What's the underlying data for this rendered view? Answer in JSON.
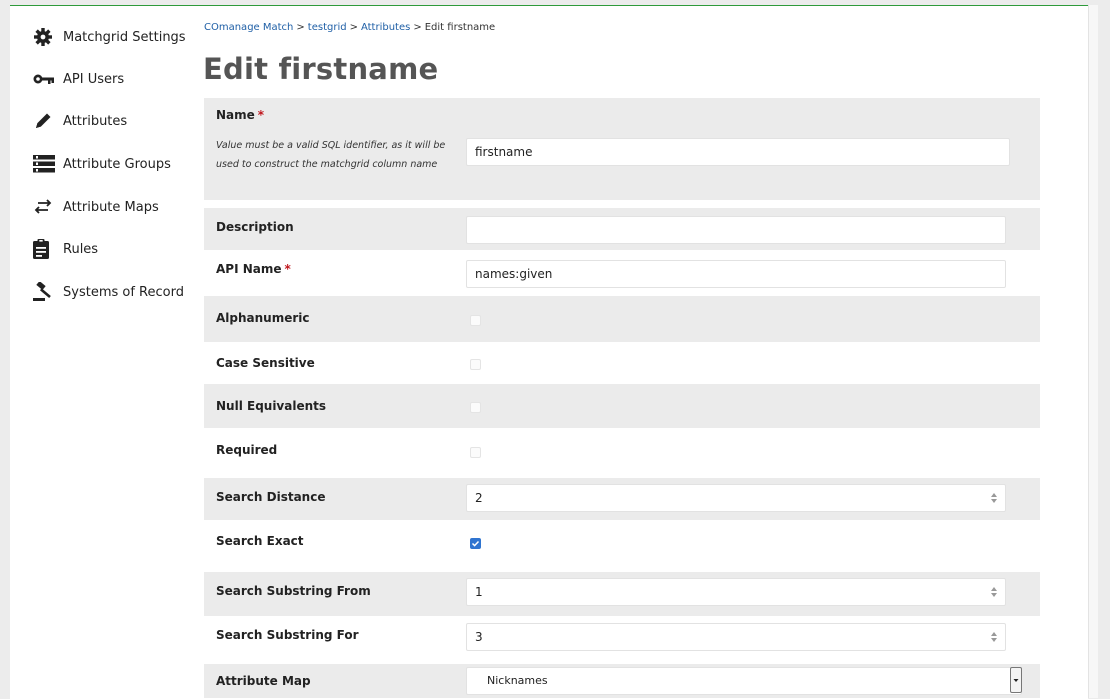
{
  "sidebar": {
    "items": [
      {
        "label": "Matchgrid Settings",
        "icon": "gear-icon"
      },
      {
        "label": "API Users",
        "icon": "key-icon"
      },
      {
        "label": "Attributes",
        "icon": "pencil-icon"
      },
      {
        "label": "Attribute Groups",
        "icon": "list-icon"
      },
      {
        "label": "Attribute Maps",
        "icon": "exchange-arrows-icon"
      },
      {
        "label": "Rules",
        "icon": "clipboard-icon"
      },
      {
        "label": "Systems of Record",
        "icon": "gavel-icon"
      }
    ]
  },
  "breadcrumb": {
    "items": [
      "COmanage Match",
      "testgrid",
      "Attributes"
    ],
    "separator": ">",
    "current": "Edit firstname"
  },
  "page": {
    "title": "Edit firstname"
  },
  "form": {
    "name": {
      "label": "Name",
      "required": "*",
      "hint": "Value must be a valid SQL identifier, as it will be used to construct the matchgrid column name",
      "value": "firstname"
    },
    "description": {
      "label": "Description",
      "value": ""
    },
    "api_name": {
      "label": "API Name",
      "required": "*",
      "value": "names:given"
    },
    "alphanumeric": {
      "label": "Alphanumeric",
      "checked": false
    },
    "case_sensitive": {
      "label": "Case Sensitive",
      "checked": false
    },
    "null_equivalents": {
      "label": "Null Equivalents",
      "checked": false
    },
    "required": {
      "label": "Required",
      "checked": false
    },
    "search_distance": {
      "label": "Search Distance",
      "value": "2"
    },
    "search_exact": {
      "label": "Search Exact",
      "checked": true
    },
    "search_substring_from": {
      "label": "Search Substring From",
      "value": "1"
    },
    "search_substring_for": {
      "label": "Search Substring For",
      "value": "3"
    },
    "attribute_map": {
      "label": "Attribute Map",
      "value": "Nicknames"
    }
  },
  "colors": {
    "accent": "#2e9a3a",
    "link": "#1f5fa6",
    "required": "#c0161d",
    "checkbox_checked": "#2f74d0",
    "row_alt": "#ebebeb"
  }
}
